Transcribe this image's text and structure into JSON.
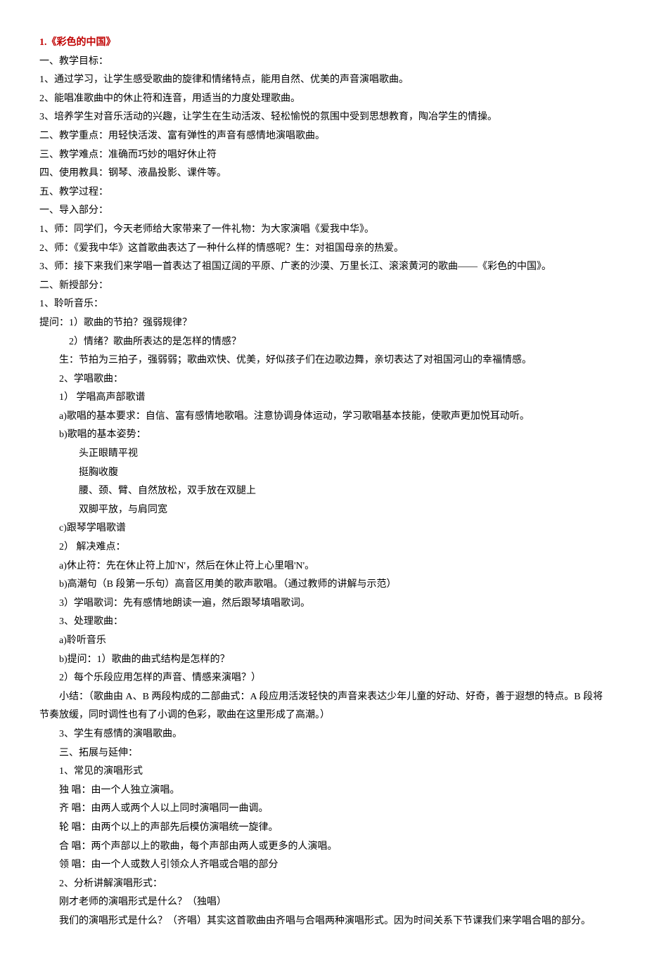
{
  "title": "1.《彩色的中国》",
  "s1_h": "一、教学目标：",
  "s1_1": "1、通过学习，让学生感受歌曲的旋律和情绪特点，能用自然、优美的声音演唱歌曲。",
  "s1_2": "2、能唱准歌曲中的休止符和连音，用适当的力度处理歌曲。",
  "s1_3": "3、培养学生对音乐活动的兴趣，让学生在生动活泼、轻松愉悦的氛围中受到思想教育，陶冶学生的情操。",
  "s2": "二、教学重点：用轻快活泼、富有弹性的声音有感情地演唱歌曲。",
  "s3": "三、教学难点：准确而巧妙的唱好休止符",
  "s4": "四、使用教具：钢琴、液晶投影、课件等。",
  "s5": "五、教学过程：",
  "p1_h": "一、导入部分：",
  "p1_1": "1、师：同学们，今天老师给大家带来了一件礼物：为大家演唱《爱我中华》。",
  "p1_2": "2、师：《爱我中华》这首歌曲表达了一种什么样的情感呢？生：对祖国母亲的热爱。",
  "p1_3": "3、师：接下来我们来学唱一首表达了祖国辽阔的平原、广袤的沙漠、万里长江、滚滚黄河的歌曲——《彩色的中国》。",
  "p2_h": "二、新授部分：",
  "p2_1": "1、聆听音乐：",
  "q_h": "提问：1）歌曲的节拍？强弱规律？",
  "q_2": "2）情绪？歌曲所表达的是怎样的情感？",
  "ans": "生：节拍为三拍子，强弱弱；歌曲欢快、优美，好似孩子们在边歌边舞，亲切表达了对祖国河山的幸福情感。",
  "p2_2": "2、学唱歌曲：",
  "sub1": "1）             学唱高声部歌谱",
  "a1": "a)歌唱的基本要求：自信、富有感情地歌唱。注意协调身体运动，学习歌唱基本技能，使歌声更加悦耳动听。",
  "b1": "b)歌唱的基本姿势：",
  "pos1": "头正眼睛平视",
  "pos2": "挺胸收腹",
  "pos3": "腰、颈、臂、自然放松，双手放在双腿上",
  "pos4": "双脚平放，与肩同宽",
  "c1": "c)跟琴学唱歌谱",
  "sub2": "2）             解决难点：",
  "a2": "a)休止符：先在休止符上加'N'，然后在休止符上心里唱'N'。",
  "b2": "b)高潮句（B 段第一乐句）高音区用美的歌声歌唱。（通过教师的讲解与示范）",
  "sub3": "3）学唱歌词：先有感情地朗读一遍，然后跟琴填唱歌词。",
  "p2_3": "3、处理歌曲：",
  "a3": "a)聆听音乐",
  "b3": "b)提问：1）歌曲的曲式结构是怎样的？",
  "b3_2": "2）每个乐段应用怎样的声音、情感来演唱？）",
  "summary": "小结：（歌曲由 A、B 两段构成的二部曲式：A 段应用活泼轻快的声音来表达少年儿童的好动、好奇，善于遐想的特点。B 段将节奏放缓，同时调性也有了小调的色彩，歌曲在这里形成了高潮。）",
  "p2_4": "3、学生有感情的演唱歌曲。",
  "p3_h": "三、拓展与延伸：",
  "p3_1": "1、常见的演唱形式",
  "f1_label": "独  唱：",
  "f1_desc": "由一个人独立演唱。",
  "f2_label": "齐  唱：",
  "f2_desc": "由两人或两个人以上同时演唱同一曲调。",
  "f3_label": "轮  唱：",
  "f3_desc": "由两个以上的声部先后模仿演唱统一旋律。",
  "f4_label": "合  唱：",
  "f4_desc": "两个声部以上的歌曲，每个声部由两人或更多的人演唱。",
  "f5_label": "领  唱：",
  "f5_desc": "由一个人或数人引领众人齐唱或合唱的部分",
  "p3_2": "2、分析讲解演唱形式：",
  "p3_2a": "刚才老师的演唱形式是什么？（独唱）",
  "p3_2b": "我们的演唱形式是什么？（齐唱）其实这首歌曲由齐唱与合唱两种演唱形式。因为时间关系下节课我们来学唱合唱的部分。"
}
